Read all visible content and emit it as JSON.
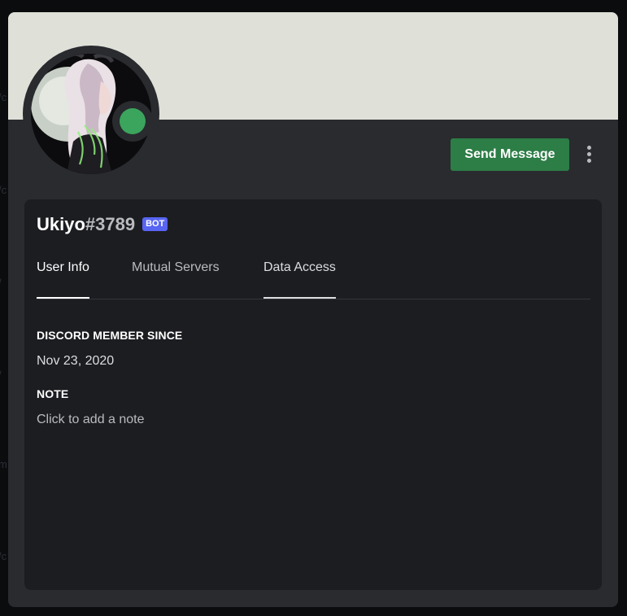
{
  "profile": {
    "username": "Ukiyo",
    "discriminator": "#3789",
    "bot_tag": "BOT",
    "status": "online",
    "status_color": "#3ba55d",
    "banner_color": "#dfe1d9"
  },
  "actions": {
    "send_message_label": "Send Message",
    "send_message_color": "#2d7d46",
    "more_icon": "vertical-ellipsis-icon"
  },
  "tabs": [
    {
      "label": "User Info",
      "state": "selected"
    },
    {
      "label": "Mutual Servers",
      "state": "default"
    },
    {
      "label": "Data Access",
      "state": "underlined"
    }
  ],
  "user_info": {
    "member_since_title": "DISCORD MEMBER SINCE",
    "member_since_value": "Nov 23, 2020",
    "note_title": "NOTE",
    "note_placeholder": "Click to add a note"
  }
}
